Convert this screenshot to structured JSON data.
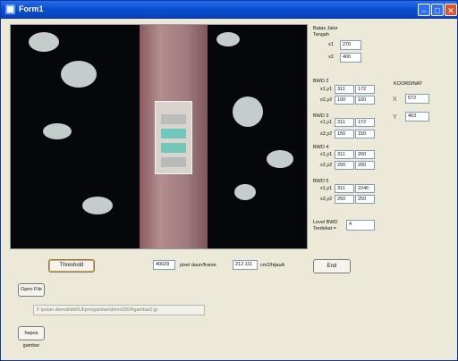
{
  "window": {
    "title": "Form1",
    "minimize": "–",
    "maximize": "□",
    "close": "✕"
  },
  "batas": {
    "heading_line1": "Batas Jalur",
    "heading_line2": "Tengah",
    "x1_label": "x1",
    "x1_value": "270",
    "x2_label": "x2",
    "x2_value": "400"
  },
  "bwd2": {
    "title": "BWD 2",
    "r1_label": "x1,y1",
    "r1_a": "311",
    "r1_b": "172",
    "r2_label": "x2,y2",
    "r2_a": "100",
    "r2_b": "100"
  },
  "bwd3": {
    "title": "BWD 3",
    "r1_label": "x1,y1",
    "r1_a": "311",
    "r1_b": "172",
    "r2_label": "x2,y2",
    "r2_a": "150",
    "r2_b": "150"
  },
  "bwd4": {
    "title": "BWD 4",
    "r1_label": "x1,y1",
    "r1_a": "311",
    "r1_b": "200",
    "r2_label": "x2,y2",
    "r2_a": "200",
    "r2_b": "200"
  },
  "bwd5": {
    "title": "BWD 5",
    "r1_label": "x1,y1",
    "r1_a": "311",
    "r1_b": "2246",
    "r2_label": "x2,y2",
    "r2_a": "250",
    "r2_b": "250"
  },
  "level": {
    "label_line1": "Level BWD",
    "label_line2": "Terdekat =",
    "value": "4"
  },
  "koordinat": {
    "title": "KOORDINAT",
    "x_label": "X",
    "x_value": "572",
    "y_label": "Y",
    "y_value": "463"
  },
  "controls": {
    "threshold_button": "Threshold",
    "pixel_value": "40029",
    "pixel_label": "pixel daun/frame",
    "cm_value": "212.111",
    "cm_label": "cm2/hijauA",
    "end_button": "End",
    "open_file_button": "Open File",
    "file_path": "F:\\pelan diemal\\dkRUI\\pro\\gambar\\dimo\\2004\\gambar2.jp",
    "hapus_button": "hapus gambar"
  }
}
